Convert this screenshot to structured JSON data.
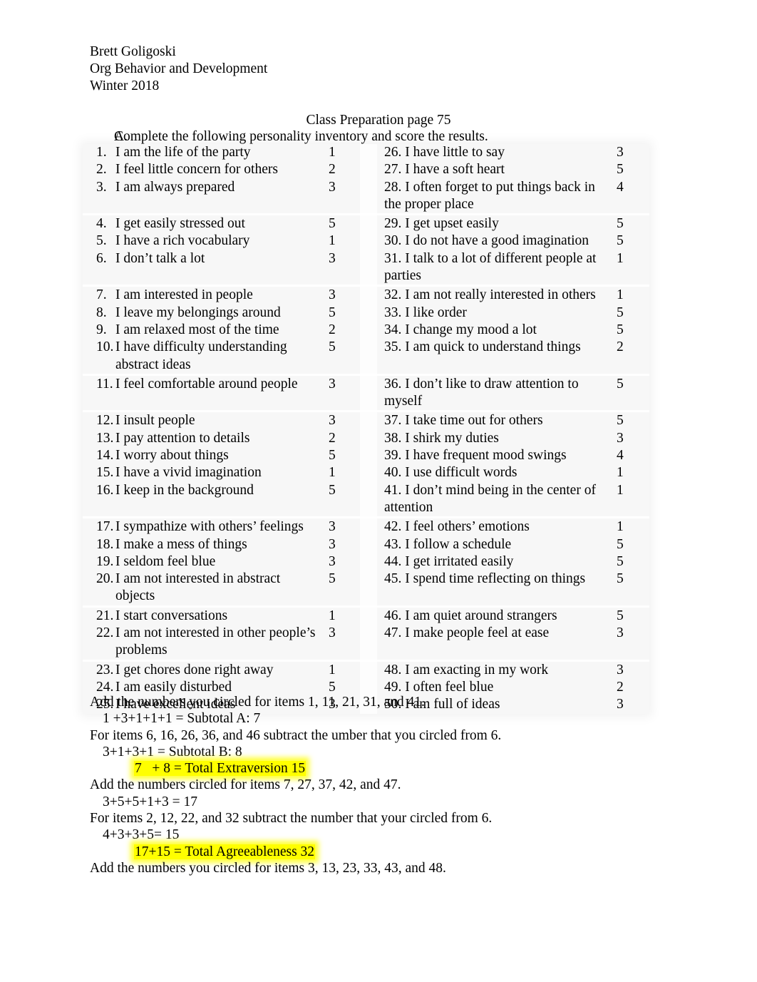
{
  "header": {
    "name": "Brett Goligoski",
    "course": "Org Behavior and Development",
    "term": "Winter 2018"
  },
  "title": "Class Preparation page 75",
  "instruction": {
    "marker": "A.",
    "text": "Complete the following personality inventory and score the results."
  },
  "inventory": {
    "rows": [
      {
        "l_num": "1.",
        "l_text": "I am the life of the party",
        "l_score": "1",
        "r_text": "26. I have little to say",
        "r_score": "3"
      },
      {
        "l_num": "2.",
        "l_text": "I feel little concern for others",
        "l_score": "2",
        "r_text": "27. I have a soft heart",
        "r_score": "5"
      },
      {
        "l_num": "3.",
        "l_text": "I am always prepared",
        "l_score": "3",
        "r_text": "28. I often forget to put things back in the proper place",
        "r_score": "4"
      },
      {
        "l_num": "4.",
        "l_text": "I get easily stressed out",
        "l_score": "5",
        "r_text": "29. I get upset easily",
        "r_score": "5"
      },
      {
        "l_num": "5.",
        "l_text": "I have a rich vocabulary",
        "l_score": "1",
        "r_text": "30. I do not have a good imagination",
        "r_score": "5"
      },
      {
        "l_num": "6.",
        "l_text": "I don’t talk a lot",
        "l_score": "3",
        "r_text": "31. I talk to a lot of different people at parties",
        "r_score": "1"
      },
      {
        "l_num": "7.",
        "l_text": "I am interested in people",
        "l_score": "3",
        "r_text": "32. I am not really interested in others",
        "r_score": "1"
      },
      {
        "l_num": "8.",
        "l_text": "I leave my belongings around",
        "l_score": "5",
        "r_text": "33. I like order",
        "r_score": "5"
      },
      {
        "l_num": "9.",
        "l_text": "I am relaxed most of the time",
        "l_score": "2",
        "r_text": "34. I change my mood a lot",
        "r_score": "5"
      },
      {
        "l_num": "10.",
        "l_text": "I have difficulty understanding abstract ideas",
        "l_score": "5",
        "r_text": "35. I am quick to understand things",
        "r_score": "2"
      },
      {
        "l_num": "11.",
        "l_text": "I feel comfortable around people",
        "l_score": "3",
        "r_text": "36. I don’t like to draw attention to myself",
        "r_score": "5"
      },
      {
        "l_num": "12.",
        "l_text": "I insult people",
        "l_score": "3",
        "r_text": "37. I take time out for others",
        "r_score": "5"
      },
      {
        "l_num": "13.",
        "l_text": "I pay attention to details",
        "l_score": "2",
        "r_text": "38. I shirk my duties",
        "r_score": "3"
      },
      {
        "l_num": "14.",
        "l_text": "I worry about things",
        "l_score": "5",
        "r_text": "39. I have frequent mood swings",
        "r_score": "4"
      },
      {
        "l_num": "15.",
        "l_text": "I have a vivid imagination",
        "l_score": "1",
        "r_text": "40. I use difficult words",
        "r_score": "1"
      },
      {
        "l_num": "16.",
        "l_text": "I keep in the background",
        "l_score": "5",
        "r_text": "41. I don’t mind being in the center of attention",
        "r_score": "1"
      },
      {
        "l_num": "17.",
        "l_text": "I sympathize with others’ feelings",
        "l_score": "3",
        "r_text": "42. I feel others’ emotions",
        "r_score": "1"
      },
      {
        "l_num": "18.",
        "l_text": "I make a mess of things",
        "l_score": "3",
        "r_text": "43. I follow a schedule",
        "r_score": "5"
      },
      {
        "l_num": "19.",
        "l_text": "I seldom feel blue",
        "l_score": "3",
        "r_text": "44. I get irritated easily",
        "r_score": "5"
      },
      {
        "l_num": "20.",
        "l_text": "I am not interested in abstract objects",
        "l_score": "5",
        "r_text": "45. I spend time reflecting on things",
        "r_score": "5"
      },
      {
        "l_num": "21.",
        "l_text": "I start conversations",
        "l_score": "1",
        "r_text": "46. I am quiet around strangers",
        "r_score": "5"
      },
      {
        "l_num": "22.",
        "l_text": "I am not interested in other people’s problems",
        "l_score": "3",
        "r_text": "47. I make people feel at ease",
        "r_score": "3"
      },
      {
        "l_num": "23.",
        "l_text": "I get chores done right away",
        "l_score": "1",
        "r_text": "48. I am exacting in my work",
        "r_score": "3"
      },
      {
        "l_num": "24.",
        "l_text": "I am easily disturbed",
        "l_score": "5",
        "r_text": "49. I often feel blue",
        "r_score": "2"
      },
      {
        "l_num": "25.",
        "l_text": "I have excellent ideas",
        "l_score": "3",
        "r_text": "50. I am full of ideas",
        "r_score": "3"
      }
    ]
  },
  "scoring": {
    "line1": "Add the numbers you circled for items 1, 11, 21, 31, and 41.",
    "line2": "1 +3+1+1+1 = Subtotal A: 7",
    "line3": "For items 6, 16, 26, 36, and 46 subtract the umber that you circled from 6.",
    "line4": "3+1+3+1 = Subtotal B: 8",
    "line5_highlight": "7   + 8 = Total Extraversion 15",
    "line6": "Add the numbers circled for items 7, 27, 37, 42, and 47.",
    "line7": "3+5+5+1+3 = 17",
    "line8": "For items 2, 12, 22, and 32 subtract the number that your circled from 6.",
    "line9": "4+3+3+5= 15",
    "line10_highlight": "17+15 = Total Agreeableness 32",
    "line11": "Add the numbers you circled for items 3, 13, 23, 33, 43, and 48."
  },
  "colors": {
    "highlight": "#ffff00",
    "text": "#000000",
    "page_background": "#ffffff",
    "table_cell": "#f7f7f7"
  }
}
